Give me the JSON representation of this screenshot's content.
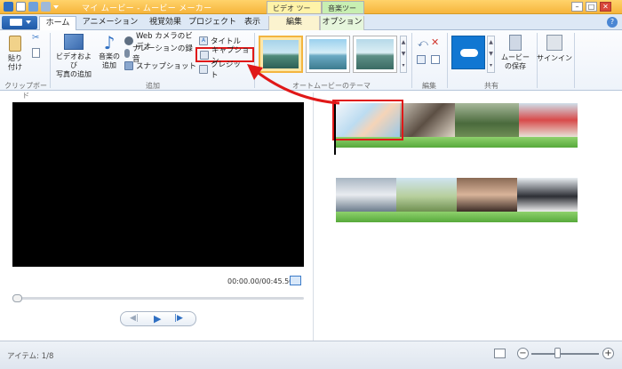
{
  "window": {
    "title": "マイ ムービー - ムービー メーカー",
    "context_labels": {
      "video_tools": "ビデオ ツール",
      "music_tools": "音楽ツール"
    },
    "controls": {
      "minimize": "–",
      "maximize": "□",
      "close": "✕"
    }
  },
  "tabs": [
    {
      "label": "ホーム",
      "active": true
    },
    {
      "label": "アニメーション",
      "active": false
    },
    {
      "label": "視覚効果",
      "active": false
    },
    {
      "label": "プロジェクト",
      "active": false
    },
    {
      "label": "表示",
      "active": false
    },
    {
      "label": "編集",
      "active": false
    },
    {
      "label": "オプション",
      "active": false
    }
  ],
  "ribbon": {
    "clipboard": {
      "paste": "貼り付け",
      "group": "クリップボード"
    },
    "add": {
      "add_videos": "ビデオおよび\n写真の追加",
      "add_music": "音楽の\n追加",
      "webcam": "Web カメラのビデオ",
      "narration": "ナレーションの録音",
      "snapshot": "スナップショット",
      "title": "タイトル",
      "caption": "キャプション",
      "credits": "クレジット",
      "group": "追加"
    },
    "themes": {
      "group": "オートムービーのテーマ"
    },
    "edit": {
      "group": "編集"
    },
    "share": {
      "save_movie": "ムービー\nの保存",
      "group": "共有"
    },
    "signin": {
      "label": "サインイン"
    }
  },
  "player": {
    "time": "00:00.00/00:45.50",
    "progress": 0
  },
  "status": {
    "items": "アイテム: 1/8",
    "zoom_level": 0.4
  },
  "colors": {
    "highlight": "#e01818",
    "accent": "#3d7cc9",
    "audio": "#57a93b"
  }
}
